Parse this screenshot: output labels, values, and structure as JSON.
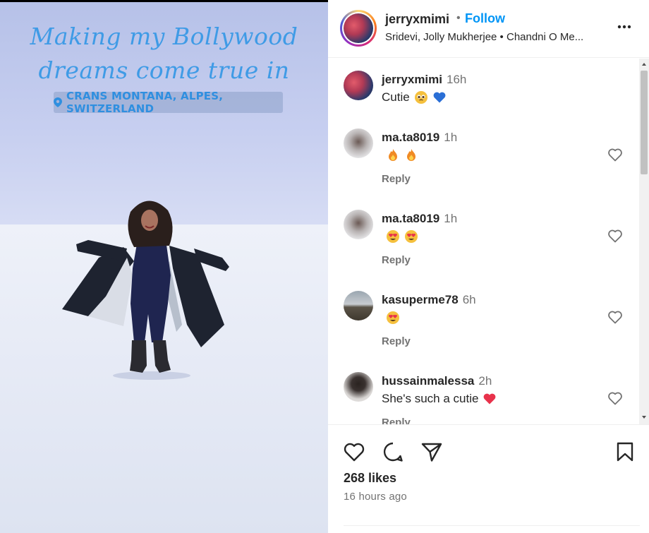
{
  "media": {
    "caption_line1": "Making my Bollywood",
    "caption_line2": "dreams come true in",
    "location": "CRANS MONTANA, ALPES, SWITZERLAND"
  },
  "header": {
    "username": "jerryxmimi",
    "separator": "•",
    "follow_label": "Follow",
    "audio": "Sridevi, Jolly Mukherjee • Chandni O Me..."
  },
  "comments": [
    {
      "username": "jerryxmimi",
      "time": "16h",
      "text": "Cutie",
      "emojis": [
        "pleading-face",
        "blue-heart"
      ],
      "has_reply": false
    },
    {
      "username": "ma.ta8019",
      "time": "1h",
      "text": "",
      "emojis": [
        "fire",
        "fire"
      ],
      "has_reply": true
    },
    {
      "username": "ma.ta8019",
      "time": "1h",
      "text": "",
      "emojis": [
        "heart-eyes",
        "heart-eyes"
      ],
      "has_reply": true
    },
    {
      "username": "kasuperme78",
      "time": "6h",
      "text": "",
      "emojis": [
        "heart-eyes"
      ],
      "has_reply": true
    },
    {
      "username": "hussainmalessa",
      "time": "2h",
      "text": "She's such a cutie",
      "emojis": [
        "red-heart"
      ],
      "has_reply": true
    }
  ],
  "reply_label": "Reply",
  "likes": "268 likes",
  "time_ago": "16 hours ago",
  "colors": {
    "accent": "#0095f6",
    "caption": "#3f9be6",
    "text": "#262626",
    "muted": "#737373"
  }
}
